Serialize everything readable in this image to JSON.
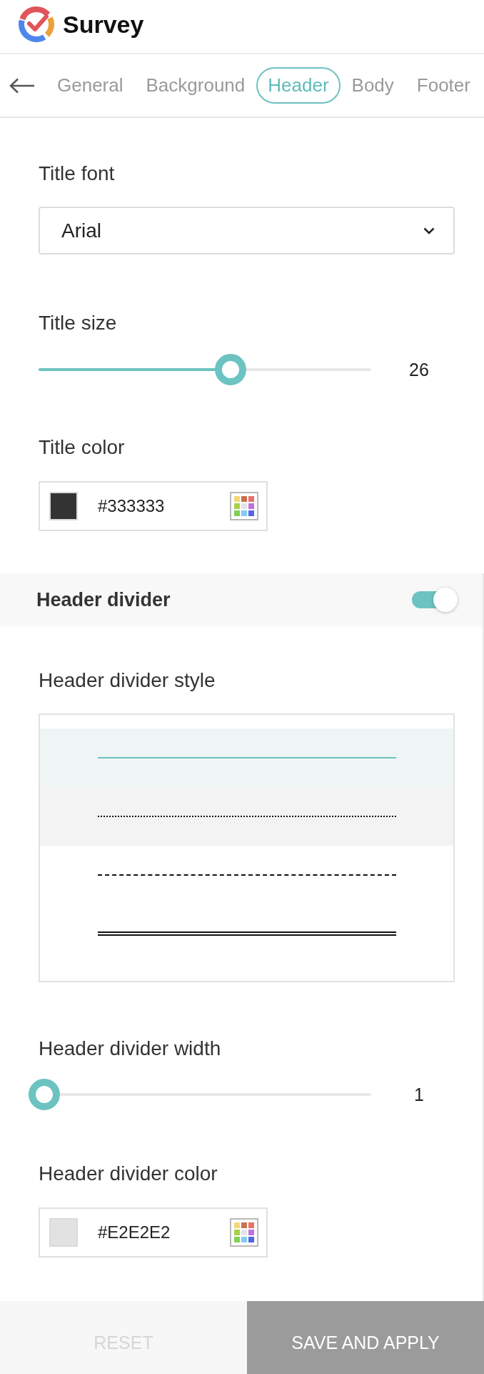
{
  "app": {
    "title": "Survey"
  },
  "tabs": [
    {
      "label": "General",
      "selected": false
    },
    {
      "label": "Background",
      "selected": false
    },
    {
      "label": "Header",
      "selected": true
    },
    {
      "label": "Body",
      "selected": false
    },
    {
      "label": "Footer",
      "selected": false
    }
  ],
  "title_font": {
    "label": "Title font",
    "value": "Arial"
  },
  "title_size": {
    "label": "Title size",
    "level": 0.57,
    "reading": "26"
  },
  "title_color": {
    "label": "Title color",
    "value": "#333333",
    "color": "#333333"
  },
  "header_divider": {
    "label": "Header divider",
    "on": true
  },
  "divider_style": {
    "label": "Header divider style",
    "options": [
      {
        "kind": "solid",
        "selected": true,
        "hovered": false
      },
      {
        "kind": "dotted",
        "selected": false,
        "hovered": true
      },
      {
        "kind": "dashed",
        "selected": false,
        "hovered": false
      },
      {
        "kind": "double",
        "selected": false,
        "hovered": false
      }
    ]
  },
  "divider_width": {
    "label": "Header divider width",
    "level": 0,
    "reading": "1"
  },
  "divider_color": {
    "label": "Header divider color",
    "value": "#E2E2E2",
    "color": "#e2e2e2"
  },
  "buttons": [
    {
      "label": "RESET",
      "kind": "secondary",
      "disabled": true
    },
    {
      "label": "SAVE AND APPLY",
      "kind": "primary",
      "disabled": true
    }
  ]
}
